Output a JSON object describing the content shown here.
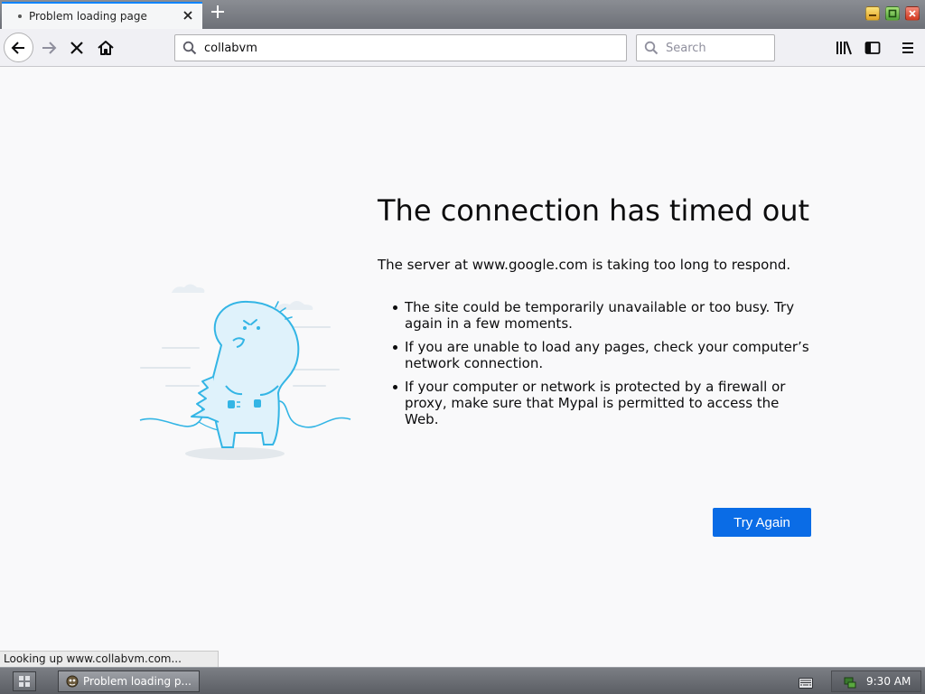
{
  "window": {
    "tab_title": "Problem loading page",
    "tab_close_icon": "close-icon",
    "new_tab_icon": "plus-icon",
    "controls": [
      "minimize-icon",
      "maximize-icon",
      "close-icon"
    ]
  },
  "toolbar": {
    "url": "collabvm",
    "search_placeholder": "Search",
    "icons": [
      "back-icon",
      "forward-icon",
      "stop-icon",
      "home-icon",
      "library-icon",
      "sidebar-icon",
      "menu-icon"
    ]
  },
  "error": {
    "title": "The connection has timed out",
    "description": "The server at www.google.com is taking too long to respond.",
    "bullets": [
      "The site could be temporarily unavailable or too busy. Try again in a few moments.",
      "If you are unable to load any pages, check your computer’s network connection.",
      "If your computer or network is protected by a firewall or proxy, make sure that Mypal is permitted to access the Web."
    ],
    "try_again_label": "Try Again"
  },
  "status": {
    "text": "Looking up www.collabvm.com..."
  },
  "taskbar": {
    "task_label": "Problem loading p...",
    "clock": "9:30 AM"
  },
  "colors": {
    "accent": "#0a6ce6",
    "page_background": "#f9f9fa",
    "illustration_stroke": "#33b5e5"
  }
}
